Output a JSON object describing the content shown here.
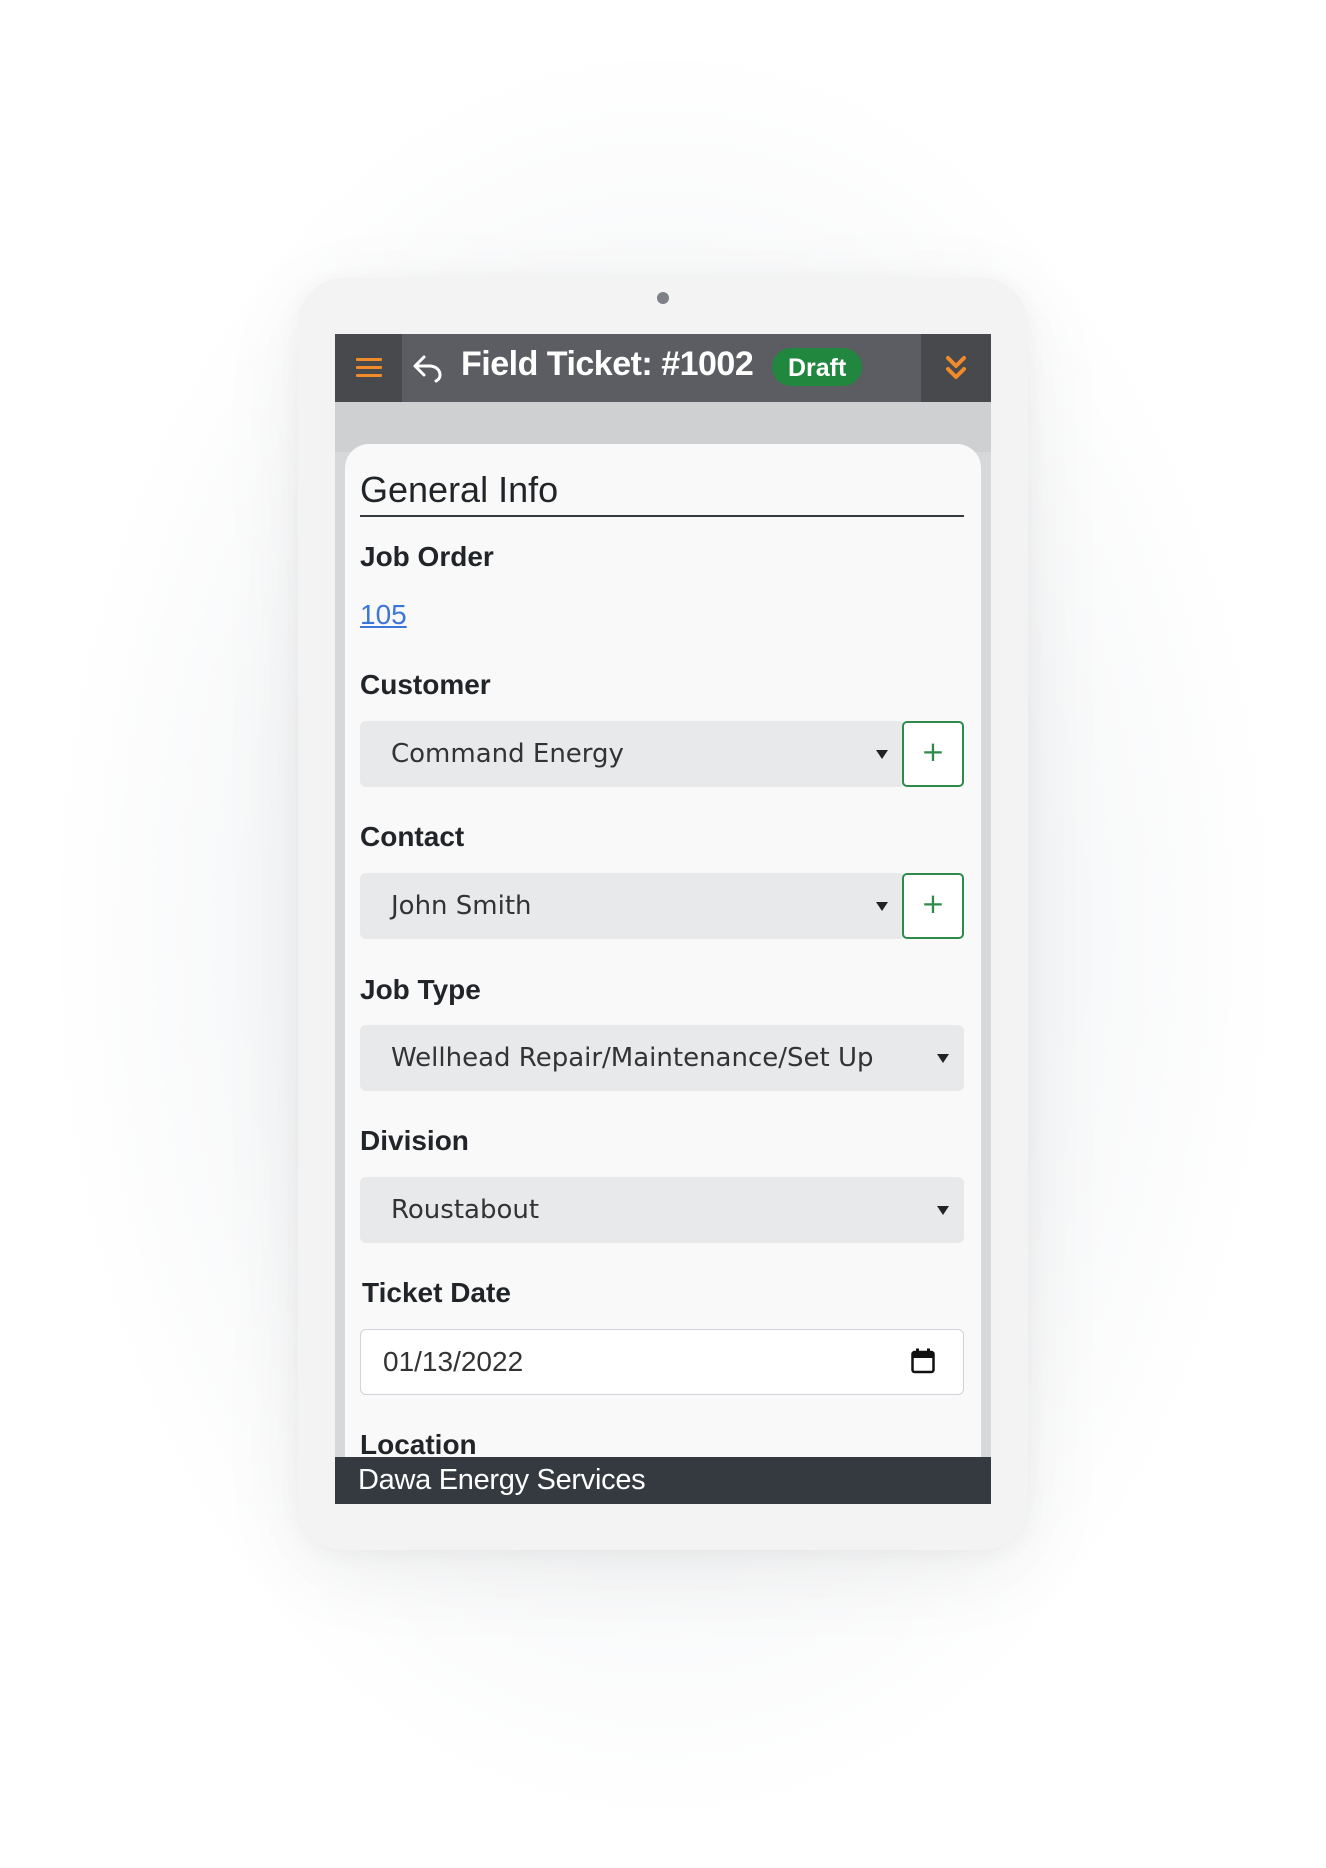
{
  "header": {
    "title": "Field Ticket: #1002",
    "status_badge": "Draft",
    "menu_icon": "hamburger-icon",
    "back_icon": "back-arrow-icon",
    "expand_icon": "double-chevron-down-icon"
  },
  "section": {
    "title": "General Info"
  },
  "fields": {
    "job_order": {
      "label": "Job Order",
      "value": "105"
    },
    "customer": {
      "label": "Customer",
      "value": "Command Energy",
      "add_label": "+"
    },
    "contact": {
      "label": "Contact",
      "value": "John Smith",
      "add_label": "+"
    },
    "job_type": {
      "label": "Job Type",
      "value": "Wellhead Repair/Maintenance/Set Up"
    },
    "division": {
      "label": "Division",
      "value": "Roustabout"
    },
    "ticket_date": {
      "label": "Ticket Date",
      "value": "01/13/2022"
    },
    "location": {
      "label": "Location"
    }
  },
  "footer": {
    "company": "Dawa Energy Services"
  },
  "colors": {
    "navbar": "#5b5d62",
    "accent_orange": "#f08b2b",
    "badge_green": "#21873f",
    "add_button_green": "#2f8a4a",
    "link_blue": "#3b76d8",
    "footer": "#343a40"
  }
}
